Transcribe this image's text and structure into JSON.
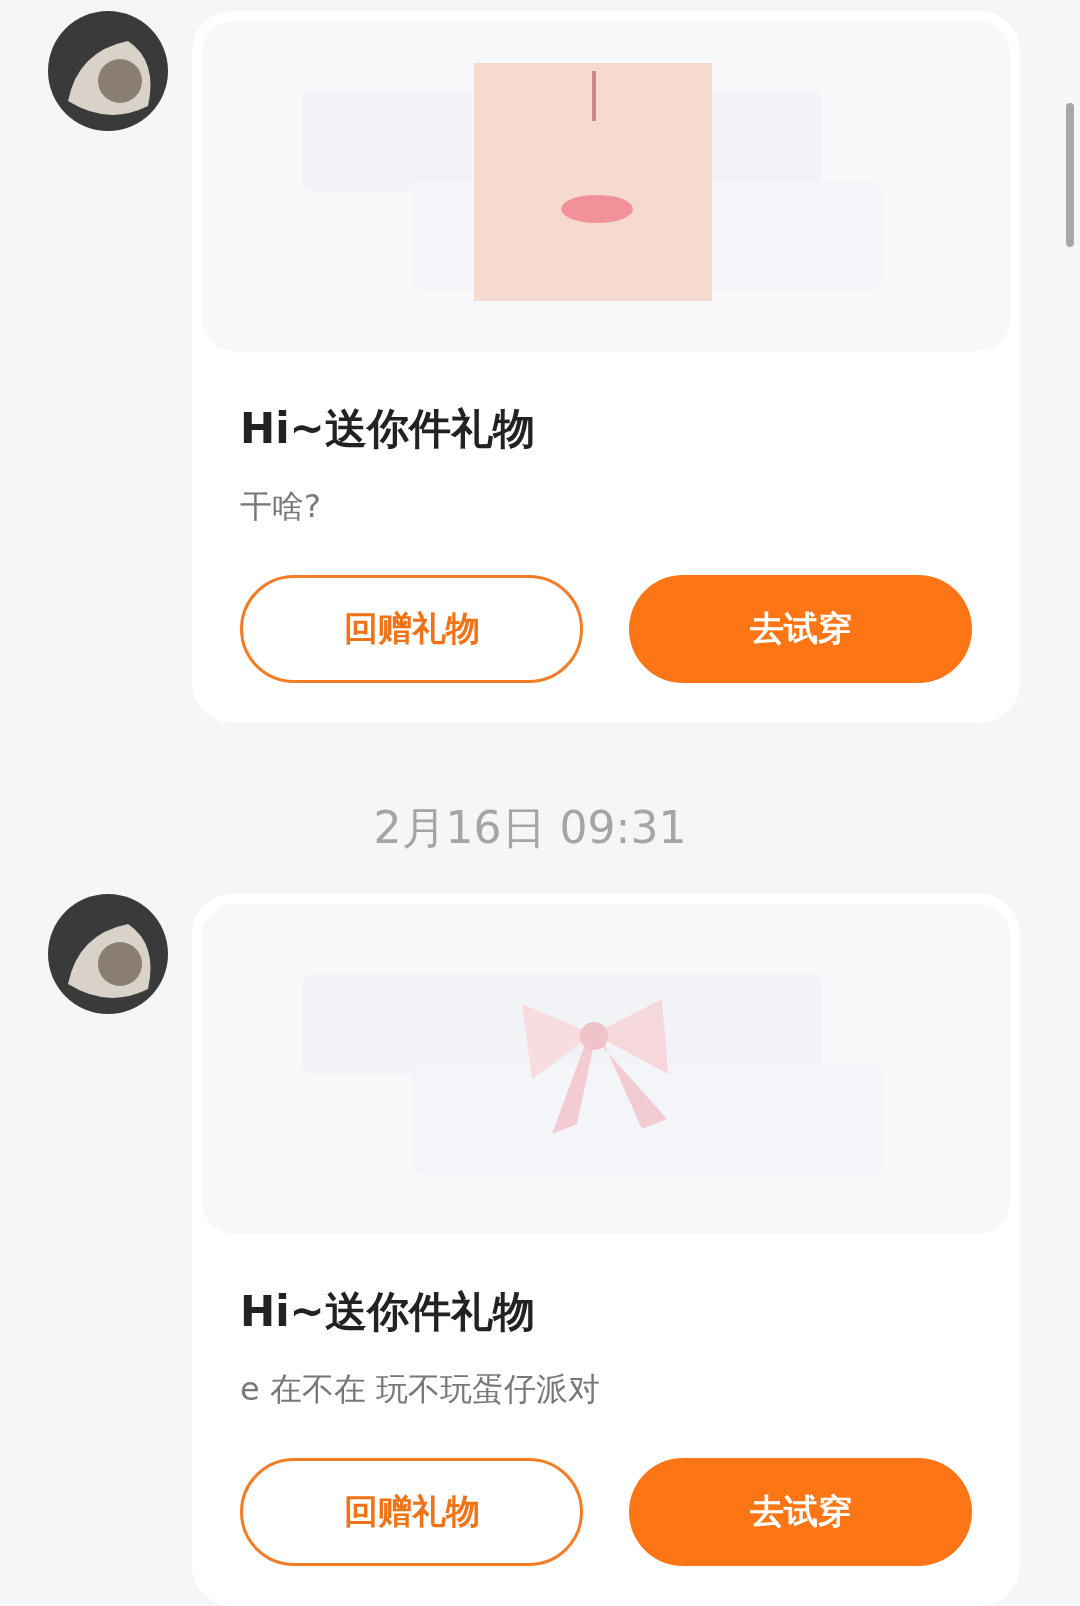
{
  "messages": [
    {
      "kind": "gift",
      "title": "Hi~送你件礼物",
      "text": "干啥?",
      "buttons": [
        {
          "kind": "outline",
          "label": "回赠礼物"
        },
        {
          "kind": "filled",
          "label": "去试穿"
        }
      ]
    },
    {
      "kind": "time",
      "text": "2月16日 09:31"
    },
    {
      "kind": "gift",
      "title": "Hi~送你件礼物",
      "text": "e 在不在 玩不玩蛋仔派对",
      "buttons": [
        {
          "kind": "outline",
          "label": "回赠礼物"
        },
        {
          "kind": "filled",
          "label": "去试穿"
        }
      ]
    }
  ]
}
